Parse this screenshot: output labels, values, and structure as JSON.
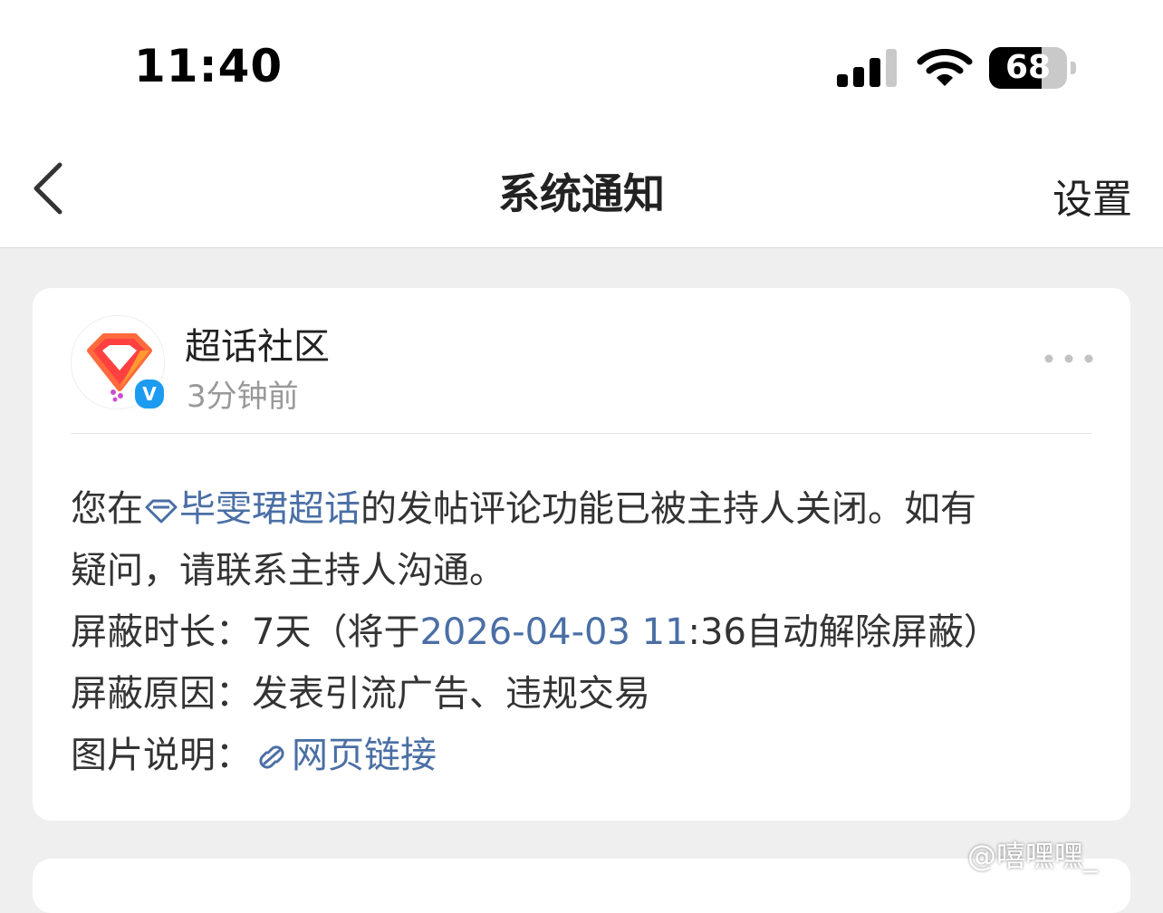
{
  "status_bar": {
    "time": "11:40",
    "battery": "68",
    "battery_level": 0.68
  },
  "nav": {
    "title": "系统通知",
    "settings_label": "设置"
  },
  "notification": {
    "sender": "超话社区",
    "time_ago": "3分钟前",
    "line1_prefix": "您在",
    "topic_link": "毕雯珺超话",
    "line1_suffix": "的发帖评论功能已被主持人关闭。如有",
    "line2": "疑问，请联系主持人沟通。",
    "duration_label": "屏蔽时长：",
    "duration_value": "7天",
    "duration_paren_open": "（将于",
    "release_time_link": "2026-04-03 11",
    "release_time_rest": ":36",
    "duration_paren_close": "自动解除屏蔽）",
    "reason_label": "屏蔽原因：",
    "reason_value": "发表引流广告、违规交易",
    "image_label": "图片说明：",
    "image_link": "网页链接"
  },
  "watermark": "@嘻嘿嘿_"
}
